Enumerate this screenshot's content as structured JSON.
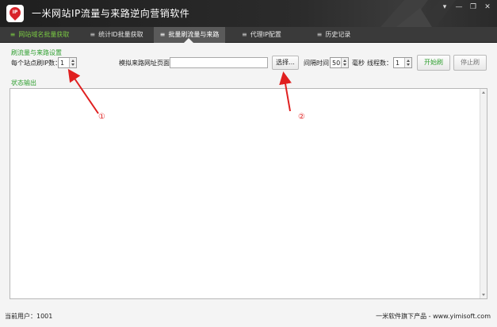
{
  "window": {
    "title": "一米网站IP流量与来路逆向营销软件",
    "logo_text": "IP",
    "controls": [
      "▾",
      "—",
      "❐",
      "✕"
    ]
  },
  "tabs": [
    {
      "label": "网站域名批量获取",
      "state": "green"
    },
    {
      "label": "统计ID批量获取",
      "state": "normal"
    },
    {
      "label": "批量刷流量与来路",
      "state": "active"
    },
    {
      "label": "代理IP配置",
      "state": "normal"
    },
    {
      "label": "历史记录",
      "state": "normal"
    }
  ],
  "settings": {
    "section_label": "刷流量与来路设置",
    "ip_per_site_label": "每个站点刷IP数：",
    "ip_per_site_value": "1",
    "source_url_label": "模拟来路网址页面：",
    "source_url_value": "",
    "choose_button": "选择...",
    "interval_label": "间隔时间",
    "interval_value": "50",
    "interval_unit": "毫秒",
    "threads_label": "线程数：",
    "threads_value": "1",
    "start_button": "开始刷",
    "stop_button": "停止刷"
  },
  "output": {
    "label": "状态输出",
    "text": ""
  },
  "status": {
    "current_user": "当前用户：1001",
    "footer": "一米软件旗下产品 - www.yimisoft.com"
  },
  "annotations": [
    {
      "label": "①"
    },
    {
      "label": "②"
    }
  ],
  "colors": {
    "titlebar": "#2b2b2b",
    "tab_green": "#7ac943",
    "section_green": "#2e9e2e",
    "annotation_red": "#e02020"
  }
}
